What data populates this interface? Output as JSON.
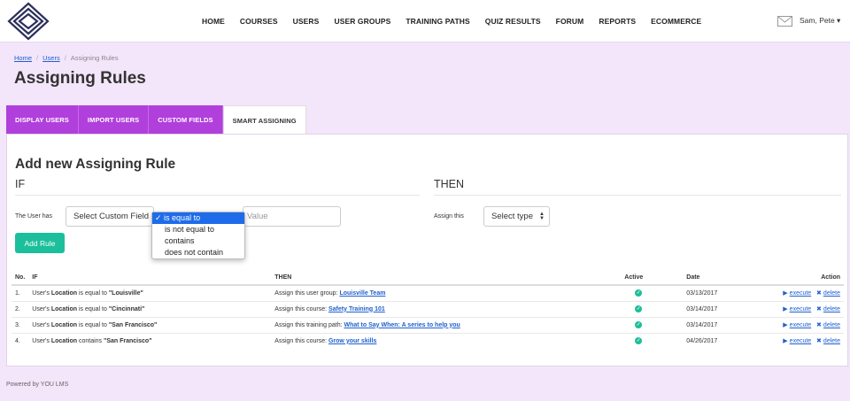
{
  "nav": {
    "items": [
      "HOME",
      "COURSES",
      "USERS",
      "USER GROUPS",
      "TRAINING PATHS",
      "QUIZ RESULTS",
      "FORUM",
      "REPORTS",
      "ECOMMERCE"
    ],
    "user": "Sam, Pete ▾"
  },
  "breadcrumb": {
    "home": "Home",
    "users": "Users",
    "current": "Assigning Rules",
    "sep": "/"
  },
  "page": {
    "title": "Assigning Rules"
  },
  "tabs": [
    "DISPLAY USERS",
    "IMPORT USERS",
    "CUSTOM FIELDS",
    "SMART ASSIGNING"
  ],
  "form": {
    "title": "Add new Assigning Rule",
    "if_heading": "IF",
    "then_heading": "THEN",
    "user_has_label": "The User has",
    "custom_field_select": "Select Custom Field",
    "value_placeholder": "Value",
    "assign_this_label": "Assign this",
    "type_select": "Select type",
    "add_rule_button": "Add Rule",
    "operator_options": [
      {
        "label": "is equal to",
        "selected": true
      },
      {
        "label": "is not equal to",
        "selected": false
      },
      {
        "label": "contains",
        "selected": false
      },
      {
        "label": "does not contain",
        "selected": false
      }
    ]
  },
  "table": {
    "headers": {
      "no": "No.",
      "if": "IF",
      "then": "THEN",
      "active": "Active",
      "date": "Date",
      "action": "Action"
    },
    "execute_label": "execute",
    "delete_label": "delete",
    "rows": [
      {
        "no": "1.",
        "if_prefix": "User's",
        "field": "Location",
        "op": "is equal to",
        "value": "\"Louisville\"",
        "then_text": "Assign this user group:",
        "then_link": "Louisville Team",
        "active": true,
        "date": "03/13/2017"
      },
      {
        "no": "2.",
        "if_prefix": "User's",
        "field": "Location",
        "op": "is equal to",
        "value": "\"Cincinnati\"",
        "then_text": "Assign this course:",
        "then_link": "Safety Training 101",
        "active": true,
        "date": "03/14/2017"
      },
      {
        "no": "3.",
        "if_prefix": "User's",
        "field": "Location",
        "op": "is equal to",
        "value": "\"San Francisco\"",
        "then_text": "Assign this training path:",
        "then_link": "What to Say When: A series to help you",
        "active": true,
        "date": "03/14/2017"
      },
      {
        "no": "4.",
        "if_prefix": "User's",
        "field": "Location",
        "op": "contains",
        "value": "\"San Francisco\"",
        "then_text": "Assign this course:",
        "then_link": "Grow your skills",
        "active": true,
        "date": "04/26/2017"
      }
    ]
  },
  "footer": {
    "text": "Powered by YOU LMS"
  },
  "colors": {
    "accent": "#b13fdc",
    "success": "#1bbf9b",
    "link": "#2060d0",
    "background": "#f3e5fa"
  }
}
